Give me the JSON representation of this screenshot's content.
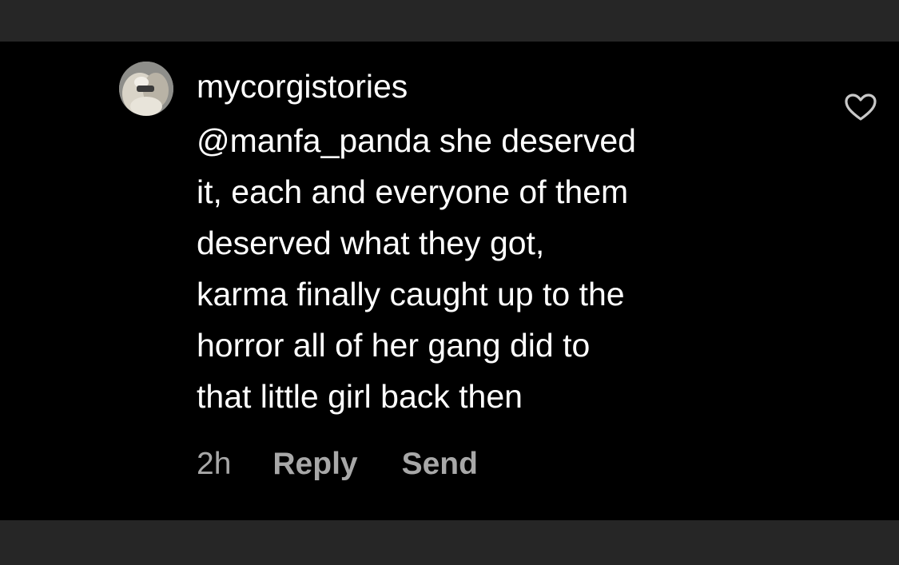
{
  "comment": {
    "username": "mycorgistories",
    "text_lines": [
      "@manfa_panda she deserved",
      "it, each and everyone of them",
      "deserved what they got,",
      "karma finally caught up to the",
      "horror all of her gang did to",
      "that little girl back then"
    ],
    "timestamp": "2h",
    "reply_label": "Reply",
    "send_label": "Send",
    "like_icon": "heart-outline-icon"
  },
  "colors": {
    "background": "#000000",
    "frame": "#262626",
    "text": "#ffffff",
    "secondary_text": "#a8a8a8"
  }
}
